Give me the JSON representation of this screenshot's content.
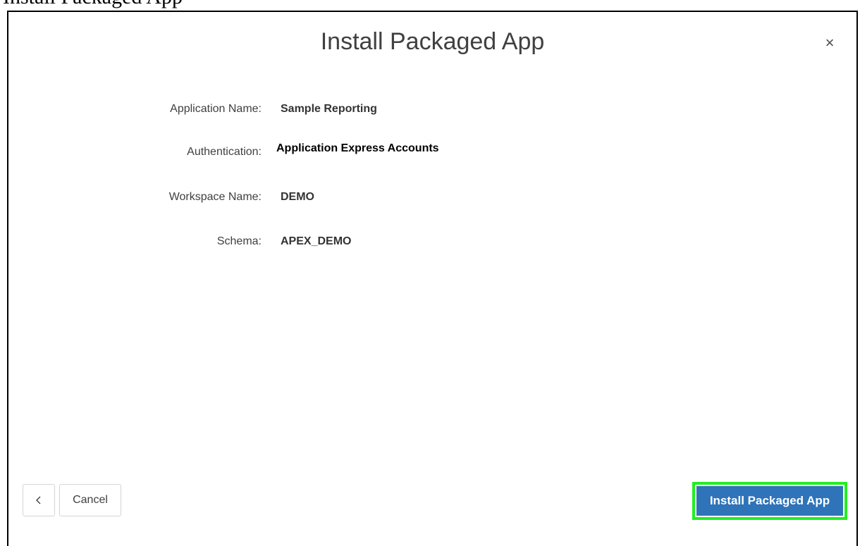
{
  "caption": "Install Packaged App",
  "dialog": {
    "title": "Install Packaged App",
    "close_label": "×"
  },
  "fields": [
    {
      "label": "Application Name:",
      "value": "Sample Reporting"
    },
    {
      "label": "Authentication:",
      "value": "Application Express Accounts"
    },
    {
      "label": "Workspace Name:",
      "value": "DEMO"
    },
    {
      "label": "Schema:",
      "value": "APEX_DEMO"
    }
  ],
  "footer": {
    "back_icon": "chevron-left-icon",
    "cancel_label": "Cancel",
    "install_label": "Install Packaged App"
  },
  "colors": {
    "primary": "#2f73b8",
    "highlight": "#22ee22"
  }
}
